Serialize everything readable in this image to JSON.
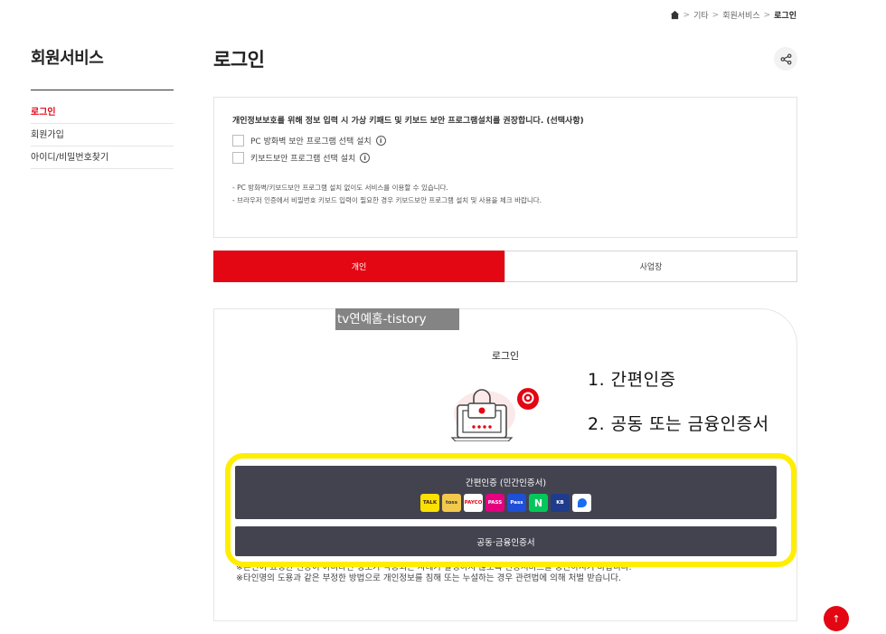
{
  "breadcrumb": {
    "items": [
      "기타",
      "회원서비스"
    ],
    "current": "로그인",
    "separator": ">"
  },
  "sidebar": {
    "title": "회원서비스",
    "items": [
      {
        "label": "로그인",
        "active": true
      },
      {
        "label": "회원가입",
        "active": false
      },
      {
        "label": "아이디/비밀번호찾기",
        "active": false
      }
    ]
  },
  "main": {
    "title": "로그인"
  },
  "notice": {
    "title": "개인정보보호를 위해 정보 입력 시 가상 키패드 및 키보드 보안 프로그램설치를 권장합니다. (선택사항)",
    "options": [
      "PC 방화벽 보안 프로그램 선택 설치",
      "키보드보안 프로그램 선택 설치"
    ],
    "info_glyph": "i",
    "notes": [
      "- PC 방화벽/키보드보안 프로그램 설치 없이도 서비스를 이용할 수 있습니다.",
      "- 브라우저 인증에서 비밀번호 키보드 입력이 필요한 경우 키보드보안 프로그램 설치 및 사용을 체크 바랍니다."
    ]
  },
  "tabs": [
    {
      "label": "개인",
      "active": true
    },
    {
      "label": "사업장",
      "active": false
    }
  ],
  "login": {
    "title": "로그인",
    "simple_auth_label": "간편인증 (민간인증서)",
    "providers": [
      "TALK",
      "toss",
      "PAYCO",
      "PASS",
      "Pass",
      "N",
      "KB",
      ""
    ],
    "cert_auth_label": "공동·금융인증서",
    "warnings": [
      "※본인이 요청한 인증이 아니라면 정보가 악용되는 사례가 발생하지 않도록 인증서비스를 중단하시기 바랍니다.",
      "※타인명의 도용과 같은 부정한 방법으로 개인정보를 침해 또는 누설하는 경우 관련법에 의해 처벌 받습니다."
    ]
  },
  "overlay": {
    "watermark": "tv연예홈-tistory",
    "annotation_1": "1. 간편인증",
    "annotation_2": "2. 공동 또는 금융인증서",
    "highlight_color": "#ffee00"
  },
  "top_button": {
    "glyph": "↑"
  },
  "colors": {
    "accent": "#e30613",
    "button_dark": "#434350"
  }
}
